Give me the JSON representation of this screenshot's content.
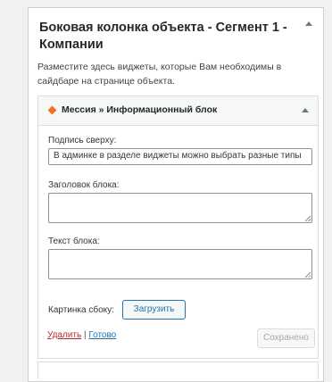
{
  "sidebar_panel": {
    "title": "Боковая колонка объекта - Сегмент 1 - Компании",
    "description": "Разместите здесь виджеты, которые Вам необходимы в сайдбаре на странице объекта."
  },
  "widget": {
    "title": "Мессия » Информационный блок",
    "caption_label": "Подпись сверху:",
    "caption_value": "В админке в разделе виджеты можно выбрать разные типы",
    "block_title_label": "Заголовок блока:",
    "block_text_label": "Текст блока:",
    "side_image_label": "Картинка сбоку:",
    "upload_button": "Загрузить",
    "delete_link": "Удалить",
    "separator": "|",
    "done_link": "Готово",
    "saved_button": "Сохранено"
  },
  "colors": {
    "accent": "#2271b1",
    "delete": "#b32d2e",
    "widget_icon": "#f0721d"
  }
}
